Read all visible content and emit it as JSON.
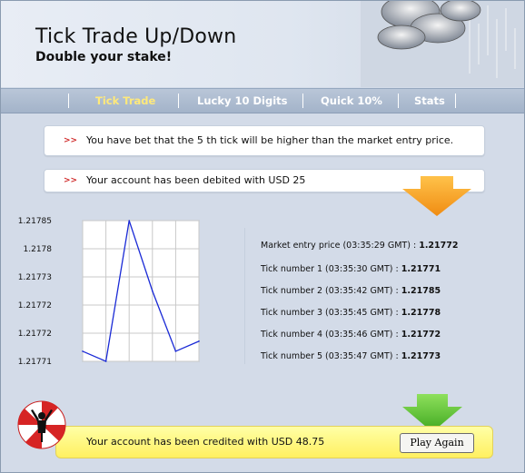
{
  "header": {
    "title": "Tick Trade Up/Down",
    "subtitle": "Double your stake!"
  },
  "nav": {
    "tabs": [
      {
        "label": "Tick Trade",
        "active": true
      },
      {
        "label": "Lucky 10 Digits",
        "active": false
      },
      {
        "label": "Quick 10%",
        "active": false
      },
      {
        "label": "Stats",
        "active": false
      }
    ]
  },
  "messages": {
    "bet": "You have bet that the 5 th tick will be higher than the market entry price.",
    "debit": "Your account has been debited with USD 25",
    "credit": "Your account has been credited with USD 48.75"
  },
  "ticks": {
    "entry": {
      "label": "Market entry price (03:35:29 GMT) :",
      "value": "1.21772"
    },
    "rows": [
      {
        "label": "Tick number 1 (03:35:30 GMT) :",
        "value": "1.21771"
      },
      {
        "label": "Tick number 2 (03:35:42 GMT) :",
        "value": "1.21785"
      },
      {
        "label": "Tick number 3 (03:35:45 GMT) :",
        "value": "1.21778"
      },
      {
        "label": "Tick number 4 (03:35:46 GMT) :",
        "value": "1.21772"
      },
      {
        "label": "Tick number 5 (03:35:47 GMT) :",
        "value": "1.21773"
      }
    ]
  },
  "chart_data": {
    "type": "line",
    "x": [
      1,
      2,
      3,
      4,
      5,
      6
    ],
    "values": [
      1.21772,
      1.21771,
      1.21785,
      1.21778,
      1.21772,
      1.21773
    ],
    "y_tick_labels": [
      "1.21785",
      "1.2178",
      "1.21773",
      "1.21772",
      "1.21772",
      "1.21771"
    ],
    "line_color": "#1a2ad6",
    "grid": true
  },
  "actions": {
    "play_again": "Play Again"
  },
  "colors": {
    "nav_active": "#ffe97a",
    "arrow_orange": "#f7a21b",
    "arrow_green": "#59c232",
    "credit_bg": "#fff27a"
  }
}
